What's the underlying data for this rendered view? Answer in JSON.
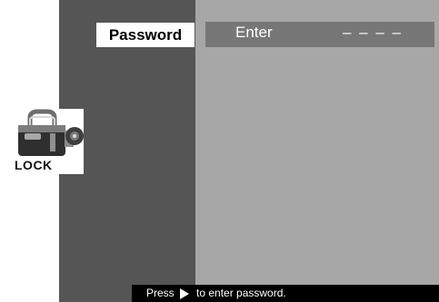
{
  "menu": {
    "password_tab": "Password"
  },
  "password_entry": {
    "label": "Enter",
    "value": "– – – –"
  },
  "lock_icon": {
    "label": "LOCK",
    "icon": "lock-icon"
  },
  "status": {
    "press_text": "Press",
    "icon": "play-icon",
    "instruction": "to enter password."
  },
  "colors": {
    "left_panel": "#555555",
    "right_panel": "#a7a7a7",
    "entry_row": "#777777",
    "status_bar": "#000000"
  }
}
